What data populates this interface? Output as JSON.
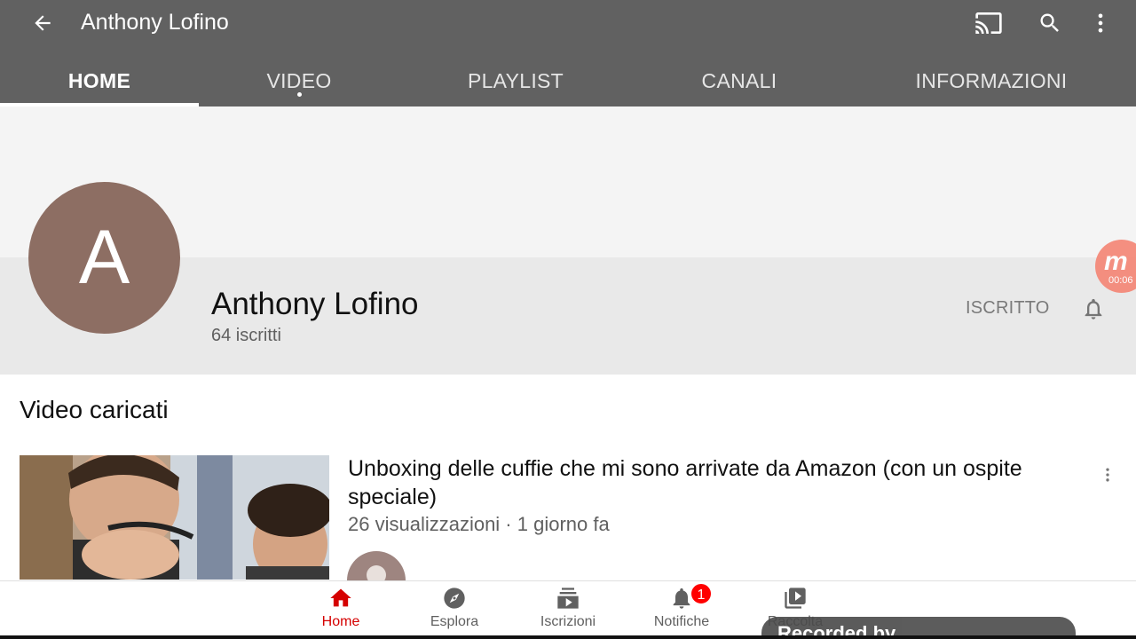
{
  "appbar": {
    "title": "Anthony Lofino",
    "icons": {
      "back": "arrow-back-icon",
      "cast": "cast-icon",
      "search": "search-icon",
      "more": "more-vert-icon"
    }
  },
  "tabs": [
    {
      "label": "HOME",
      "active": true
    },
    {
      "label": "VIDEO",
      "active": false,
      "has_dot": true
    },
    {
      "label": "PLAYLIST",
      "active": false
    },
    {
      "label": "CANALI",
      "active": false
    },
    {
      "label": "INFORMAZIONI",
      "active": false
    }
  ],
  "channel": {
    "avatar_letter": "A",
    "avatar_color": "#8d6e63",
    "name": "Anthony Lofino",
    "subscribers": "64 iscritti",
    "subscribe_label": "ISCRITTO"
  },
  "recorder": {
    "logo": "m",
    "time": "00:06",
    "watermark": "Recorded by"
  },
  "section": {
    "title": "Video caricati"
  },
  "video": {
    "title": "Unboxing delle cuffie che mi sono arrivate da Amazon (con un ospite speciale)",
    "meta": "26 visualizzazioni · 1 giorno fa"
  },
  "bottom_nav": [
    {
      "label": "Home",
      "icon": "home-icon",
      "active": true
    },
    {
      "label": "Esplora",
      "icon": "explore-compass-icon",
      "active": false
    },
    {
      "label": "Iscrizioni",
      "icon": "subscriptions-icon",
      "active": false
    },
    {
      "label": "Notifiche",
      "icon": "bell-icon",
      "active": false,
      "badge": "1"
    },
    {
      "label": "Raccolta",
      "icon": "library-icon",
      "active": false
    }
  ],
  "colors": {
    "appbar": "#616161",
    "accent": "#d50000",
    "badge": "#ff0000"
  }
}
